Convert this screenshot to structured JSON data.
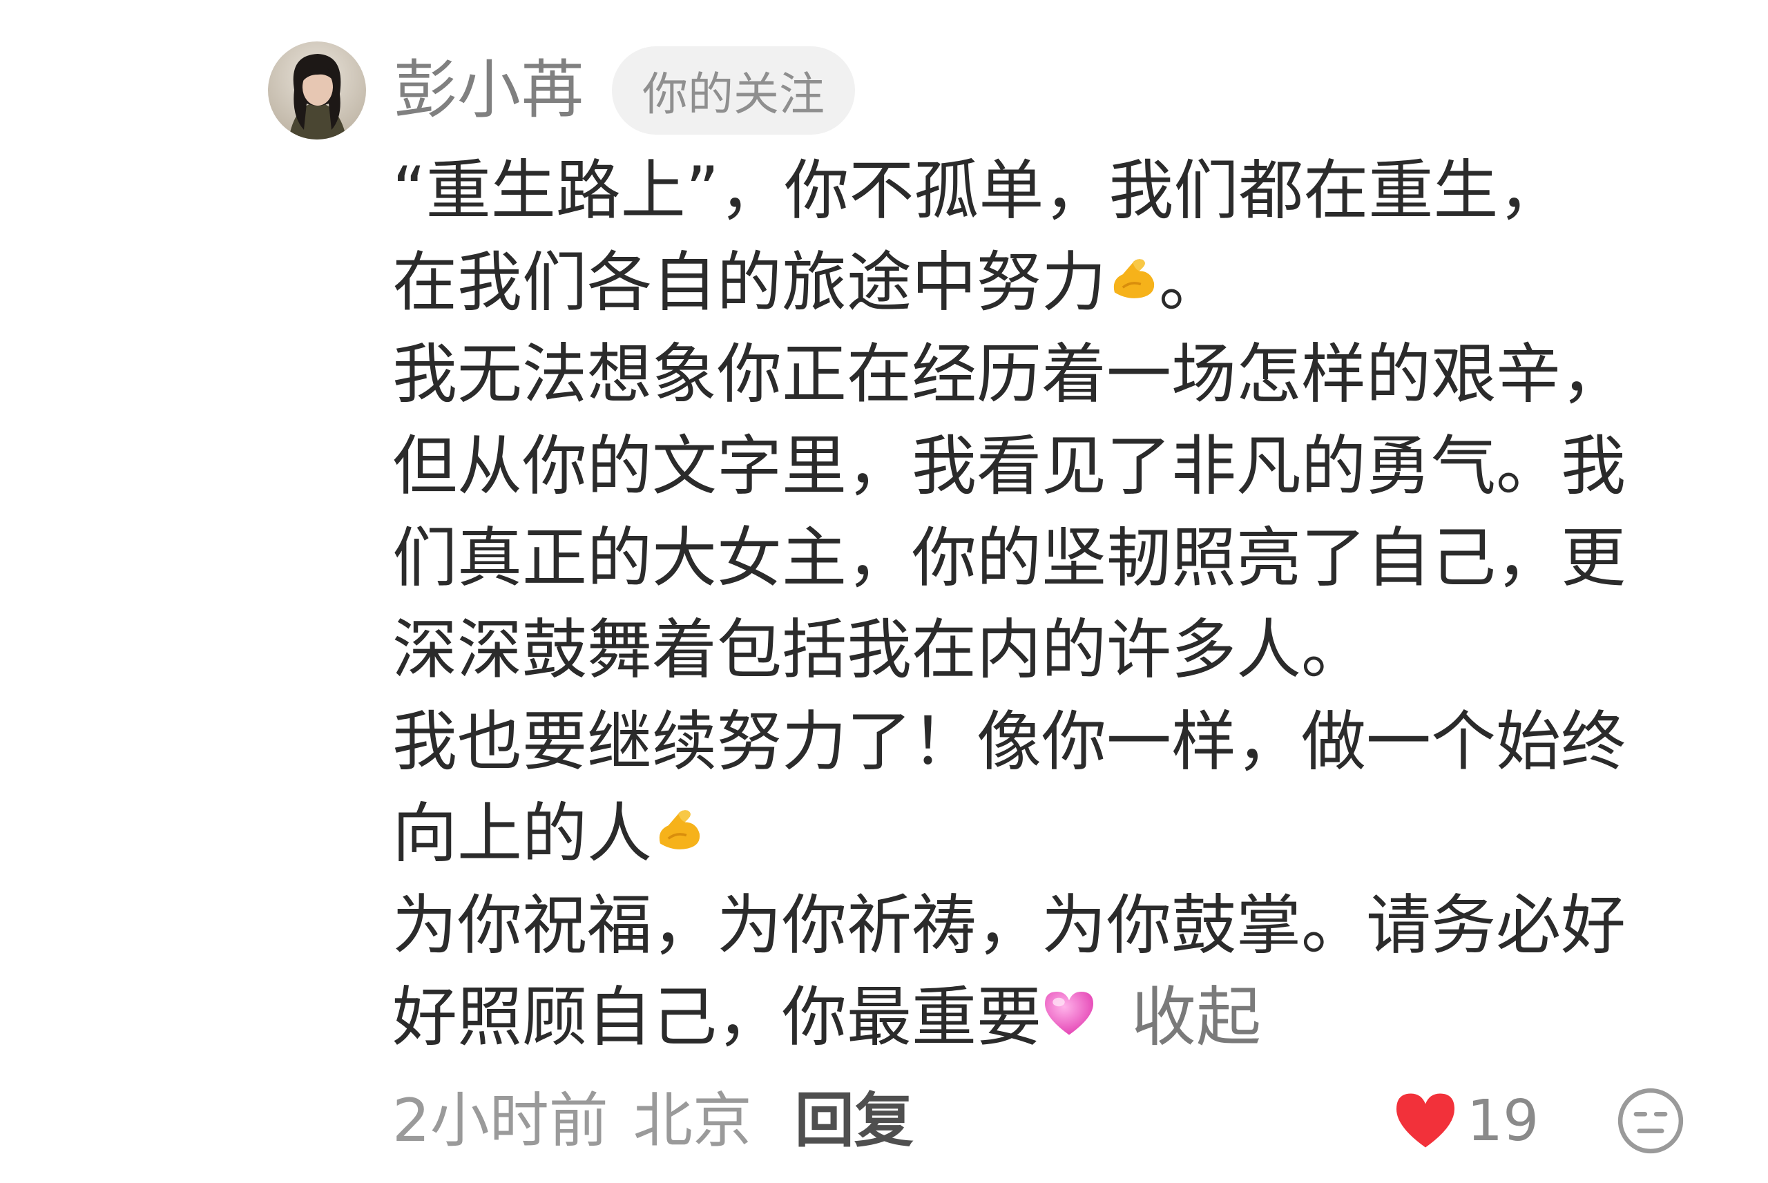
{
  "comment": {
    "user": {
      "name": "彭小苒",
      "badge": "你的关注",
      "avatar": "avatar-photo"
    },
    "body_lines": [
      "“重生路上”，你不孤单，我们都在重生，",
      "在我们各自的旅途中努力",
      "我无法想象你正在经历着一场怎样的艰辛，",
      "但从你的文字里，我看见了非凡的勇气。我",
      "们真正的大女主，你的坚韧照亮了自己，更",
      "深深鼓舞着包括我在内的许多人。",
      "我也要继续努力了！像你一样，做一个始终",
      "向上的人",
      "为你祝福，为你祈祷，为你鼓掌。请务必好",
      "好照顾自己，你最重要"
    ],
    "line2_suffix": "。",
    "collapse_label": "收起",
    "emojis": {
      "muscle": "flexed-biceps-emoji",
      "heart": "pink-heart-emoji"
    },
    "footer": {
      "time": "2小时前",
      "location": "北京",
      "reply_label": "回复",
      "like_count": "19",
      "like_icon": "heart-icon",
      "like_color": "#f2313a",
      "dislike_icon": "dislike-face-icon"
    }
  }
}
